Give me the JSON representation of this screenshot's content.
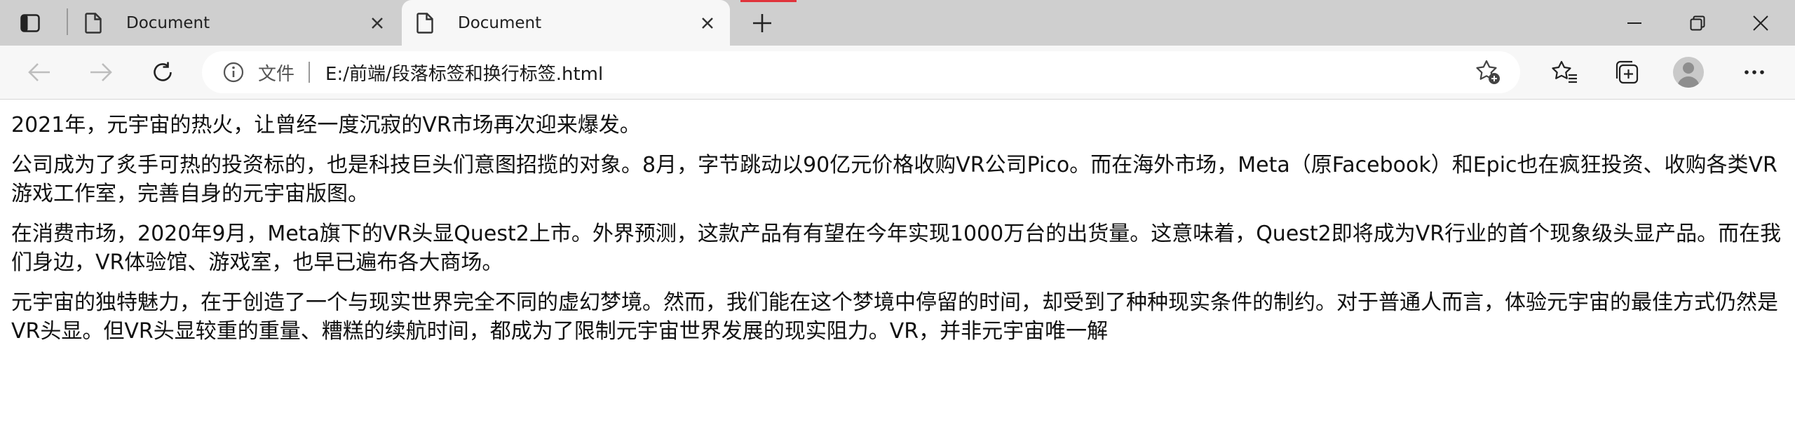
{
  "tabs": [
    {
      "title": "Document",
      "active": false
    },
    {
      "title": "Document",
      "active": true
    }
  ],
  "addressbar": {
    "site_label": "文件",
    "url": "E:/前端/段落标签和换行标签.html"
  },
  "icons": {
    "tab_actions": "tab-actions-icon",
    "document": "document-icon",
    "close": "close-icon",
    "new_tab": "plus-icon",
    "minimize": "minimize-icon",
    "restore": "restore-icon",
    "window_close": "close-icon",
    "back": "back-arrow-icon",
    "forward": "forward-arrow-icon",
    "reload": "reload-icon",
    "info": "info-icon",
    "add_favorite": "star-plus-icon",
    "favorites": "favorites-icon",
    "collections": "collections-icon",
    "profile": "profile-icon",
    "more": "more-icon"
  },
  "colors": {
    "tabstrip": "#cfcfcf",
    "toolbar": "#f7f7f7",
    "loading": "#e0343c"
  },
  "paragraphs": [
    "2021年，元宇宙的热火，让曾经一度沉寂的VR市场再次迎来爆发。",
    "公司成为了炙手可热的投资标的，也是科技巨头们意图招揽的对象。8月，字节跳动以90亿元价格收购VR公司Pico。而在海外市场，Meta（原Facebook）和Epic也在疯狂投资、收购各类VR游戏工作室，完善自身的元宇宙版图。",
    "在消费市场，2020年9月，Meta旗下的VR头显Quest2上市。外界预测，这款产品有有望在今年实现1000万台的出货量。这意味着，Quest2即将成为VR行业的首个现象级头显产品。而在我们身边，VR体验馆、游戏室，也早已遍布各大商场。",
    "元宇宙的独特魅力，在于创造了一个与现实世界完全不同的虚幻梦境。然而，我们能在这个梦境中停留的时间，却受到了种种现实条件的制约。对于普通人而言，体验元宇宙的最佳方式仍然是VR头显。但VR头显较重的重量、糟糕的续航时间，都成为了限制元宇宙世界发展的现实阻力。VR，并非元宇宙唯一解"
  ]
}
